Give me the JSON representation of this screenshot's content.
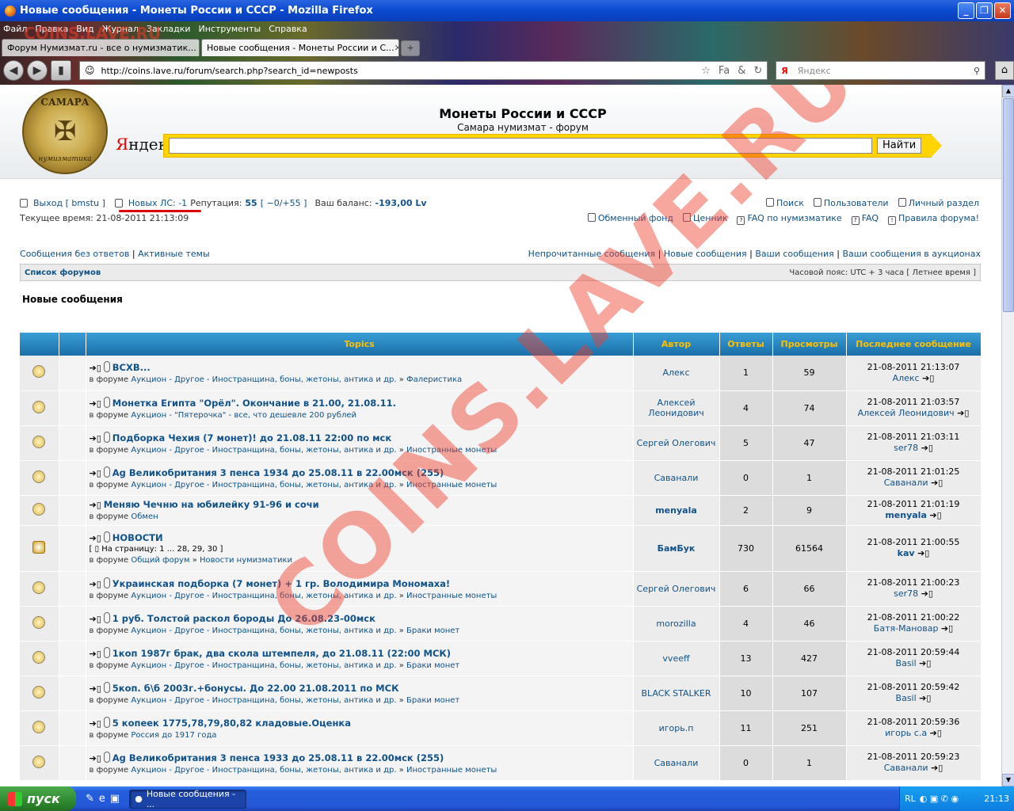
{
  "window": {
    "title": "Новые сообщения - Монеты России и СССР - Mozilla Firefox"
  },
  "menu": [
    "Файл",
    "Правка",
    "Вид",
    "Журнал",
    "Закладки",
    "Инструменты",
    "Справка"
  ],
  "tabs": [
    {
      "label": "Форум Нумизмат.ru - все о нумизматик..."
    },
    {
      "label": "Новые сообщения - Монеты России и С..."
    }
  ],
  "address": {
    "url": "http://coins.lave.ru/forum/search.php?search_id=newposts"
  },
  "searchbar": {
    "placeholder": "Яндекс"
  },
  "header": {
    "logo_top": "САМАРА",
    "logo_bottom": "нумизматика",
    "title": "Монеты России и СССР",
    "subtitle": "Самара нумизмат - форум",
    "yandex_letter": "Я",
    "yandex_rest": "ндекс",
    "search_button": "Найти"
  },
  "user": {
    "logout": "Выход [ bmstu ]",
    "pm": "Новых ЛС: -1",
    "rep_label": "Репутация:",
    "rep_value": "55",
    "rep_detail": "[ −0/+55 ]",
    "balance_label": "Ваш баланс:",
    "balance_value": "-193,00 Lv",
    "time": "Текущее время: 21-08-2011 21:13:09"
  },
  "toplinks1": [
    "Поиск",
    "Пользователи",
    "Личный раздел"
  ],
  "toplinks2": [
    "Обменный фонд",
    "Ценник",
    "FAQ по нумизматике",
    "FAQ",
    "Правила форума!"
  ],
  "nav_left": [
    "Сообщения без ответов",
    "Активные темы"
  ],
  "nav_right": [
    "Непрочитанные сообщения",
    "Новые сообщения",
    "Ваши сообщения",
    "Ваши сообщения в аукционах"
  ],
  "crumb": {
    "label": "Список форумов",
    "tz": "Часовой пояс: UTC + 3 часа [ Летнее время ]"
  },
  "page_heading": "Новые сообщения",
  "table": {
    "headers": [
      "Topics",
      "Автор",
      "Ответы",
      "Просмотры",
      "Последнее сообщение"
    ],
    "prefix_forum": "в форуме",
    "rows": [
      {
        "title": "ВСХВ...",
        "forum": "Аукцион - Другое - Иностранщина, боны, жетоны, антика и др.",
        "sub": "Фалеристика",
        "author": "Алекс",
        "replies": "1",
        "views": "59",
        "last_time": "21-08-2011 21:13:07",
        "last_user": "Алекс",
        "clip": true
      },
      {
        "title": "Монетка Египта \"Орёл\". Окончание в 21.00, 21.08.11.",
        "forum": "Аукцион - \"Пятерочка\" - все, что дешевле 200 рублей",
        "sub": "",
        "author": "Алексей Леонидович",
        "replies": "4",
        "views": "74",
        "last_time": "21-08-2011 21:03:57",
        "last_user": "Алексей Леонидович",
        "clip": true
      },
      {
        "title": "Подборка Чехия (7 монет)! до 21.08.11 22:00 по мск",
        "forum": "Аукцион - Другое - Иностранщина, боны, жетоны, антика и др.",
        "sub": "Иностранные монеты",
        "author": "Сергей Олегович",
        "replies": "5",
        "views": "47",
        "last_time": "21-08-2011 21:03:11",
        "last_user": "ser78",
        "clip": true
      },
      {
        "title": "Ag Великобритания 3 пенса 1934 до 25.08.11 в 22.00мск (255)",
        "forum": "Аукцион - Другое - Иностранщина, боны, жетоны, антика и др.",
        "sub": "Иностранные монеты",
        "author": "Саванали",
        "replies": "0",
        "views": "1",
        "last_time": "21-08-2011 21:01:25",
        "last_user": "Саванали",
        "clip": true
      },
      {
        "title": "Меняю Чечню на юбилейку 91-96 и сочи",
        "forum": "Обмен",
        "sub": "",
        "author": "menyala",
        "replies": "2",
        "views": "9",
        "last_time": "21-08-2011 21:01:19",
        "last_user": "menyala",
        "clip": false,
        "bold": true
      },
      {
        "title": "НОВОСТИ",
        "pages": "На страницу: 1 ... 28, 29, 30",
        "forum": "Общий форум",
        "sub": "Новости нумизматики",
        "author": "БамБук",
        "replies": "730",
        "views": "61564",
        "last_time": "21-08-2011 21:00:55",
        "last_user": "kav",
        "clip": true,
        "bold": true,
        "hot": true
      },
      {
        "title": "Украинская подборка (7 монет) + 1 гр. Володимира Мономаха!",
        "forum": "Аукцион - Другое - Иностранщина, боны, жетоны, антика и др.",
        "sub": "Иностранные монеты",
        "author": "Сергей Олегович",
        "replies": "6",
        "views": "66",
        "last_time": "21-08-2011 21:00:23",
        "last_user": "ser78",
        "clip": true
      },
      {
        "title": "1 руб. Толстой раскол бороды До 26.08.23-00мск",
        "forum": "Аукцион - Другое - Иностранщина, боны, жетоны, антика и др.",
        "sub": "Браки монет",
        "author": "morozilla",
        "replies": "4",
        "views": "46",
        "last_time": "21-08-2011 21:00:22",
        "last_user": "Батя-Мановар",
        "clip": true
      },
      {
        "title": "1коп 1987г брак, два скола штемпеля, до 21.08.11 (22:00 МСК)",
        "forum": "Аукцион - Другое - Иностранщина, боны, жетоны, антика и др.",
        "sub": "Браки монет",
        "author": "vveeff",
        "replies": "13",
        "views": "427",
        "last_time": "21-08-2011 20:59:44",
        "last_user": "Basil",
        "clip": true
      },
      {
        "title": "5коп. б\\б 2003г.+бонусы. До 22.00 21.08.2011 по МСК",
        "forum": "Аукцион - Другое - Иностранщина, боны, жетоны, антика и др.",
        "sub": "Браки монет",
        "author": "BLACK STALKER",
        "replies": "10",
        "views": "107",
        "last_time": "21-08-2011 20:59:42",
        "last_user": "Basil",
        "clip": true
      },
      {
        "title": "5 копеек 1775,78,79,80,82 кладовые.Оценка",
        "forum": "Россия до 1917 года",
        "sub": "",
        "author": "игорь.п",
        "replies": "11",
        "views": "251",
        "last_time": "21-08-2011 20:59:36",
        "last_user": "игорь с.а",
        "clip": true
      },
      {
        "title": "Ag Великобритания 3 пенса 1933 до 25.08.11 в 22.00мск (255)",
        "forum": "Аукцион - Другое - Иностранщина, боны, жетоны, антика и др.",
        "sub": "Иностранные монеты",
        "author": "Саванали",
        "replies": "0",
        "views": "1",
        "last_time": "21-08-2011 20:59:23",
        "last_user": "Саванали",
        "clip": true
      }
    ]
  },
  "watermark": {
    "big": "COINS.LAVE.RU",
    "small": "COINS.LAVE.RU"
  },
  "taskbar": {
    "start": "пуск",
    "item": "Новые сообщения - ...",
    "lang": "RL",
    "clock": "21:13"
  }
}
